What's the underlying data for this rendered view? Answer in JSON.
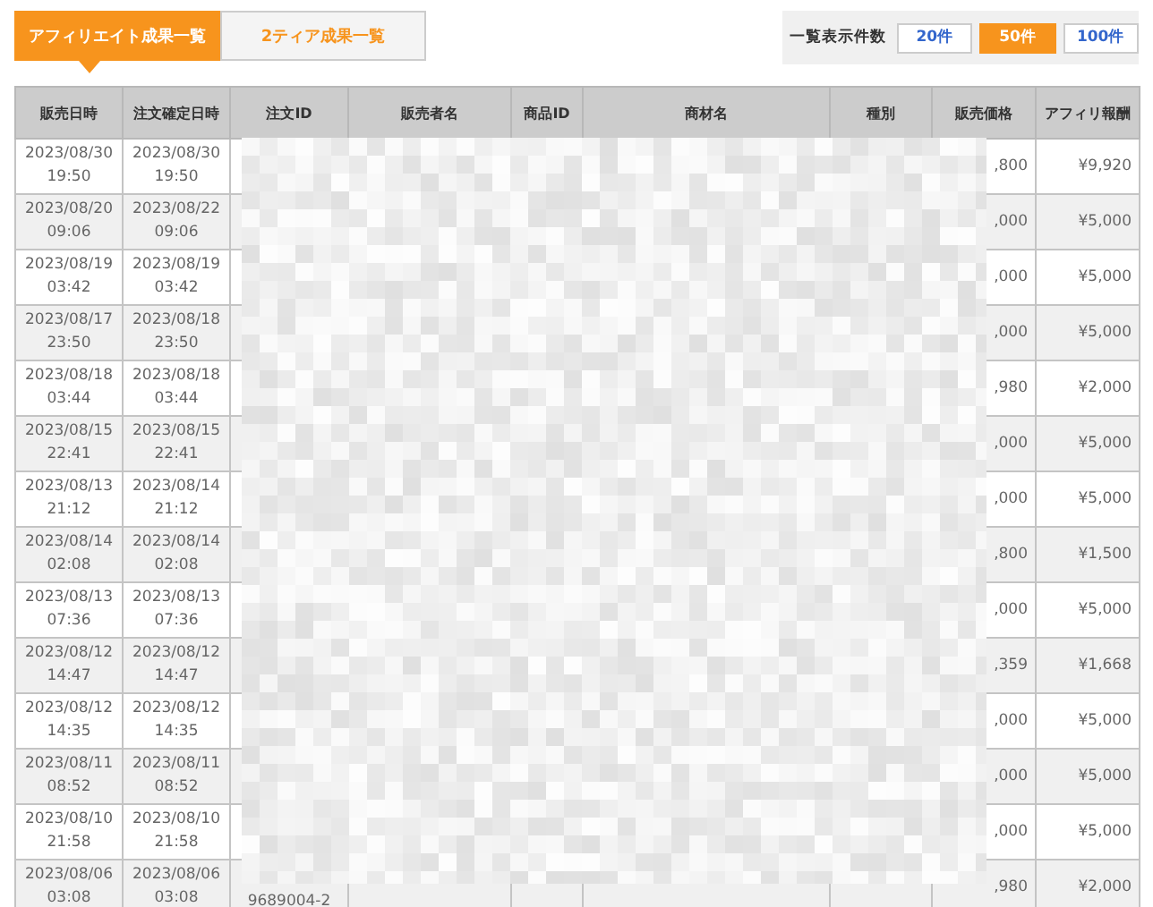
{
  "tabs": [
    {
      "label": "アフィリエイト成果一覧",
      "selected": true
    },
    {
      "label": "2ティア成果一覧",
      "selected": false
    }
  ],
  "page_size": {
    "label": "一覧表示件数",
    "options": [
      {
        "label": "20件",
        "selected": false
      },
      {
        "label": "50件",
        "selected": true
      },
      {
        "label": "100件",
        "selected": false
      }
    ]
  },
  "table": {
    "columns": [
      "販売日時",
      "注文確定日時",
      "注文ID",
      "販売者名",
      "商品ID",
      "商材名",
      "種別",
      "販売価格",
      "アフィリ報酬"
    ],
    "rows": [
      {
        "sold": "2023/08/30 19:50",
        "confirmed": "2023/08/30 19:50",
        "price": ",800",
        "reward": "¥9,920"
      },
      {
        "sold": "2023/08/20 09:06",
        "confirmed": "2023/08/22 09:06",
        "price": ",000",
        "reward": "¥5,000"
      },
      {
        "sold": "2023/08/19 03:42",
        "confirmed": "2023/08/19 03:42",
        "price": ",000",
        "reward": "¥5,000"
      },
      {
        "sold": "2023/08/17 23:50",
        "confirmed": "2023/08/18 23:50",
        "price": ",000",
        "reward": "¥5,000"
      },
      {
        "sold": "2023/08/18 03:44",
        "confirmed": "2023/08/18 03:44",
        "price": ",980",
        "reward": "¥2,000"
      },
      {
        "sold": "2023/08/15 22:41",
        "confirmed": "2023/08/15 22:41",
        "price": ",000",
        "reward": "¥5,000"
      },
      {
        "sold": "2023/08/13 21:12",
        "confirmed": "2023/08/14 21:12",
        "price": ",000",
        "reward": "¥5,000"
      },
      {
        "sold": "2023/08/14 02:08",
        "confirmed": "2023/08/14 02:08",
        "price": ",800",
        "reward": "¥1,500"
      },
      {
        "sold": "2023/08/13 07:36",
        "confirmed": "2023/08/13 07:36",
        "price": ",000",
        "reward": "¥5,000"
      },
      {
        "sold": "2023/08/12 14:47",
        "confirmed": "2023/08/12 14:47",
        "price": ",359",
        "reward": "¥1,668"
      },
      {
        "sold": "2023/08/12 14:35",
        "confirmed": "2023/08/12 14:35",
        "price": ",000",
        "reward": "¥5,000"
      },
      {
        "sold": "2023/08/11 08:52",
        "confirmed": "2023/08/11 08:52",
        "price": ",000",
        "reward": "¥5,000"
      },
      {
        "sold": "2023/08/10 21:58",
        "confirmed": "2023/08/10 21:58",
        "price": ",000",
        "reward": "¥5,000"
      },
      {
        "sold": "2023/08/06 03:08",
        "confirmed": "2023/08/06 03:08",
        "order_id": "9689004-2",
        "price": ",980",
        "reward": "¥2,000"
      }
    ]
  }
}
